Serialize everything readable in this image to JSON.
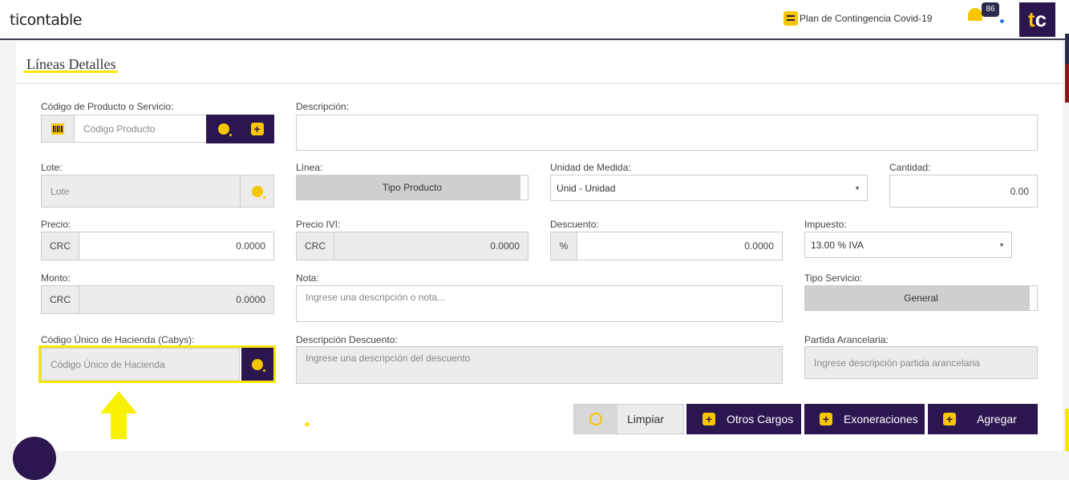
{
  "header": {
    "logo": "ticontable",
    "covid_link": "Plan de Contingencia Covid-19",
    "notifications_count": "86",
    "avatar": "tc"
  },
  "panel": {
    "title": "Líneas Detalles"
  },
  "fields": {
    "codigo_producto": {
      "label": "Código de Producto o Servicio:",
      "placeholder": "Código Producto"
    },
    "descripcion": {
      "label": "Descripción:",
      "value": ""
    },
    "lote": {
      "label": "Lote:",
      "placeholder": "Lote"
    },
    "linea": {
      "label": "Línea:",
      "value": "Tipo Producto"
    },
    "unidad": {
      "label": "Unidad de Medida:",
      "value": "Unid - Unidad"
    },
    "cantidad": {
      "label": "Cantidad:",
      "value": "0.00"
    },
    "precio": {
      "label": "Precio:",
      "currency": "CRC",
      "value": "0.0000"
    },
    "precio_ivi": {
      "label": "Precio IVI:",
      "currency": "CRC",
      "value": "0.0000"
    },
    "descuento": {
      "label": "Descuento:",
      "unit": "%",
      "value": "0.0000"
    },
    "impuesto": {
      "label": "Impuesto:",
      "value": "13.00 % IVA"
    },
    "monto": {
      "label": "Monto:",
      "currency": "CRC",
      "value": "0.0000"
    },
    "nota": {
      "label": "Nota:",
      "placeholder": "Ingrese una descripción o nota..."
    },
    "tipo_servicio": {
      "label": "Tipo Servicio:",
      "value": "General"
    },
    "cabys": {
      "label": "Código Único de Hacienda (Cabys):",
      "placeholder": "Código Único de Hacienda"
    },
    "descripcion_descuento": {
      "label": "Descripción Descuento:",
      "placeholder": "Ingrese una descripción del descuento"
    },
    "partida": {
      "label": "Partida Arancelaria:",
      "placeholder": "Ingrese descripción partida arancelaria"
    }
  },
  "actions": {
    "limpiar": "Limpiar",
    "otros_cargos": "Otros Cargos",
    "exoneraciones": "Exoneraciones",
    "agregar": "Agregar"
  },
  "colors": {
    "accent": "#f7c600",
    "brand": "#2b1650",
    "highlight": "#f7e600"
  }
}
